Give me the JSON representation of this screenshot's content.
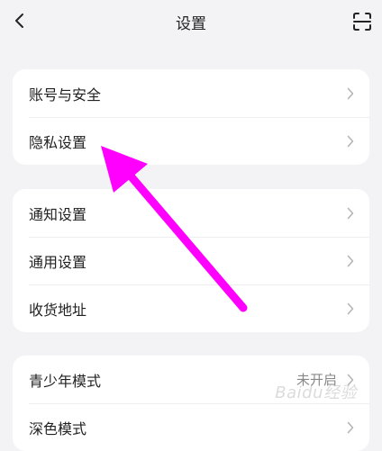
{
  "header": {
    "title": "设置",
    "back_icon": "chevron-left-icon",
    "scan_icon": "scan-icon"
  },
  "groups": [
    {
      "items": [
        {
          "label": "账号与安全"
        },
        {
          "label": "隐私设置"
        }
      ]
    },
    {
      "items": [
        {
          "label": "通知设置"
        },
        {
          "label": "通用设置"
        },
        {
          "label": "收货地址"
        }
      ]
    },
    {
      "items": [
        {
          "label": "青少年模式",
          "value": "未开启"
        },
        {
          "label": "深色模式"
        }
      ]
    }
  ],
  "annotation": {
    "arrow_color": "#ff00ff",
    "target": "隐私设置"
  },
  "watermark": "Baidu经验"
}
